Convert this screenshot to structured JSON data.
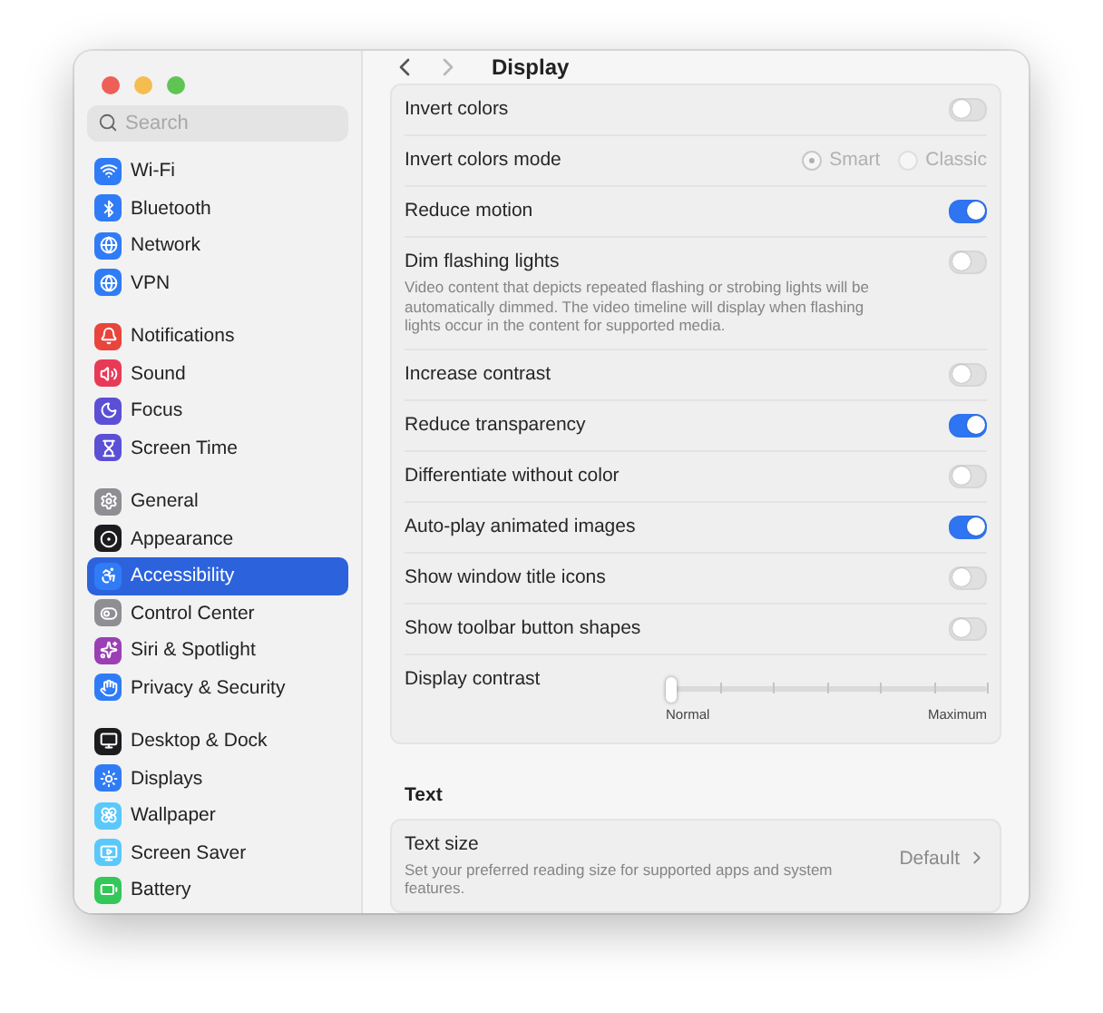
{
  "sidebar": {
    "search": {
      "placeholder": "Search"
    },
    "groups": [
      {
        "items": [
          {
            "label": "Wi-Fi",
            "color": "#2f7cf6",
            "selected": false
          },
          {
            "label": "Bluetooth",
            "color": "#2f7cf6",
            "selected": false
          },
          {
            "label": "Network",
            "color": "#2f7cf6",
            "selected": false
          },
          {
            "label": "VPN",
            "color": "#2f7cf6",
            "selected": false
          }
        ]
      },
      {
        "items": [
          {
            "label": "Notifications",
            "color": "#e8453c",
            "selected": false
          },
          {
            "label": "Sound",
            "color": "#e83a57",
            "selected": false
          },
          {
            "label": "Focus",
            "color": "#5b4fd6",
            "selected": false
          },
          {
            "label": "Screen Time",
            "color": "#5b4fd6",
            "selected": false
          }
        ]
      },
      {
        "items": [
          {
            "label": "General",
            "color": "#8e8e93",
            "selected": false
          },
          {
            "label": "Appearance",
            "color": "#1c1c1e",
            "selected": false
          },
          {
            "label": "Accessibility",
            "color": "#2f7cf6",
            "selected": true
          },
          {
            "label": "Control Center",
            "color": "#8e8e93",
            "selected": false
          },
          {
            "label": "Siri & Spotlight",
            "color": "#9b3fb5",
            "selected": false
          },
          {
            "label": "Privacy & Security",
            "color": "#2f7cf6",
            "selected": false
          }
        ]
      },
      {
        "items": [
          {
            "label": "Desktop & Dock",
            "color": "#1c1c1e",
            "selected": false
          },
          {
            "label": "Displays",
            "color": "#2f7cf6",
            "selected": false
          },
          {
            "label": "Wallpaper",
            "color": "#5ac8fa",
            "selected": false
          },
          {
            "label": "Screen Saver",
            "color": "#5ac8fa",
            "selected": false
          },
          {
            "label": "Battery",
            "color": "#34c759",
            "selected": false
          }
        ]
      }
    ]
  },
  "title": "Display",
  "settings": [
    {
      "kind": "toggle",
      "label": "Invert colors",
      "on": false
    },
    {
      "kind": "radio",
      "label": "Invert colors mode",
      "disabled": true,
      "options": [
        {
          "label": "Smart",
          "selected": true
        },
        {
          "label": "Classic",
          "selected": false
        }
      ]
    },
    {
      "kind": "toggle",
      "label": "Reduce motion",
      "on": true
    },
    {
      "kind": "toggle",
      "label": "Dim flashing lights",
      "on": false,
      "description": "Video content that depicts repeated flashing or strobing lights will be automatically dimmed. The video timeline will display when flashing lights occur in the content for supported media."
    },
    {
      "kind": "toggle",
      "label": "Increase contrast",
      "on": false
    },
    {
      "kind": "toggle",
      "label": "Reduce transparency",
      "on": true
    },
    {
      "kind": "toggle",
      "label": "Differentiate without color",
      "on": false
    },
    {
      "kind": "toggle",
      "label": "Auto-play animated images",
      "on": true
    },
    {
      "kind": "toggle",
      "label": "Show window title icons",
      "on": false
    },
    {
      "kind": "toggle",
      "label": "Show toolbar button shapes",
      "on": false
    },
    {
      "kind": "slider",
      "label": "Display contrast",
      "level": 0,
      "min_label": "Normal",
      "max_label": "Maximum"
    }
  ],
  "text_section": {
    "heading": "Text",
    "rows": [
      {
        "label": "Text size",
        "description": "Set your preferred reading size for supported apps and system features.",
        "value": "Default"
      }
    ]
  }
}
